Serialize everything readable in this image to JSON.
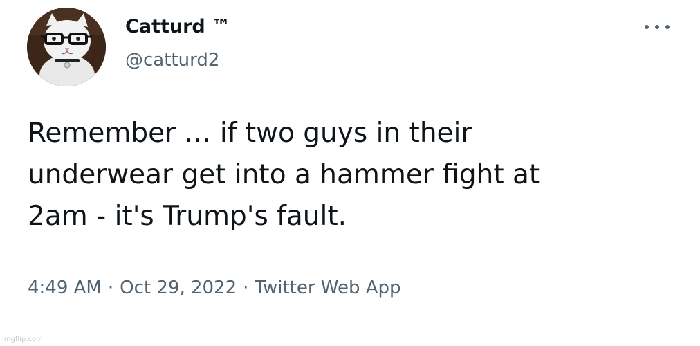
{
  "tweet": {
    "author": {
      "display_name": "Catturd ™",
      "handle": "@catturd2",
      "avatar_icon": "cat-with-glasses-avatar"
    },
    "more_icon": "more-options-icon",
    "text_lines": [
      "Remember … if two guys in their",
      "underwear get into a hammer fight at",
      "2am - it's Trump's fault."
    ],
    "time": "4:49 AM",
    "separator": "·",
    "date": "Oct 29, 2022",
    "source": "Twitter Web App"
  },
  "watermark": "imgflip.com",
  "colors": {
    "text": "#0f1419",
    "secondary": "#536471",
    "divider": "#eff3f4",
    "background": "#ffffff"
  }
}
